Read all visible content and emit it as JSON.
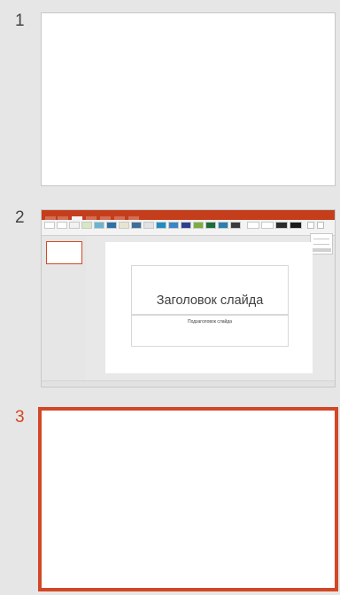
{
  "slides_pane": {
    "background": "#e6e6e6",
    "selection_color": "#d24726",
    "slides": [
      {
        "number": "1",
        "selected": false,
        "content": "blank"
      },
      {
        "number": "2",
        "selected": false,
        "content": "screenshot",
        "screenshot": {
          "app_accent": "#c43e1c",
          "slide_title": "Заголовок слайда",
          "slide_subtitle": "Подзаголовок слайда"
        }
      },
      {
        "number": "3",
        "selected": true,
        "content": "blank"
      }
    ]
  }
}
